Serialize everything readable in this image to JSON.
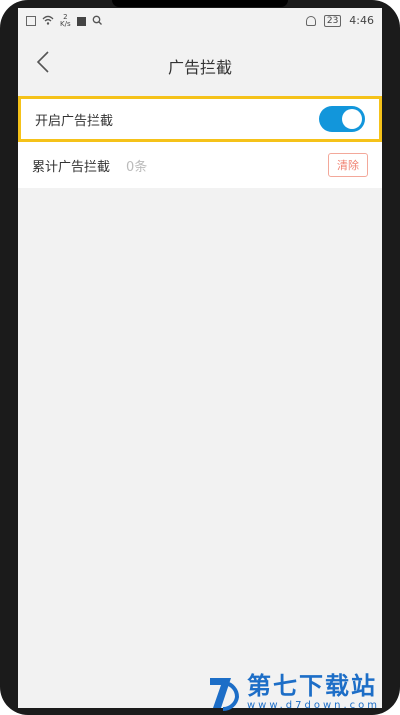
{
  "status_bar": {
    "speed_value": "2",
    "speed_unit": "K/s",
    "battery": "23",
    "time": "4:46"
  },
  "header": {
    "title": "广告拦截"
  },
  "settings": {
    "enable_label": "开启广告拦截",
    "enable_state": true,
    "count_label": "累计广告拦截",
    "count_value": "0条",
    "clear_label": "清除"
  },
  "watermark": {
    "title": "第七下载站",
    "url": "www.d7down.com"
  },
  "colors": {
    "toggle_on": "#1296db",
    "highlight": "#f5c219",
    "clear_accent": "#f08070",
    "watermark": "#1d6ec7"
  }
}
